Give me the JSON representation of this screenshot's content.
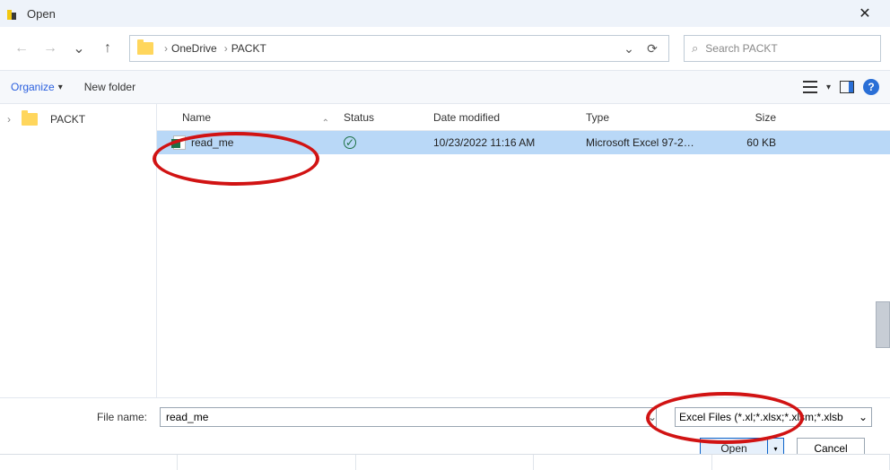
{
  "window": {
    "title": "Open"
  },
  "nav": {
    "back_hint": "←",
    "forward_hint": "→",
    "recent_hint": "⌄",
    "up_hint": "↑"
  },
  "breadcrumbs": [
    "OneDrive",
    "PACKT"
  ],
  "addressbar": {
    "history_dropdown": "⌄",
    "refresh": "⟳"
  },
  "search": {
    "icon": "⌕",
    "placeholder": "Search PACKT"
  },
  "toolbar": {
    "organize": "Organize",
    "newfolder": "New folder",
    "caret": "▾"
  },
  "sidebar": {
    "items": [
      {
        "label": "PACKT"
      }
    ]
  },
  "columns": {
    "name": "Name",
    "status": "Status",
    "date": "Date modified",
    "type": "Type",
    "size": "Size",
    "sort_indicator": "⌃"
  },
  "files": [
    {
      "name": "read_me",
      "status": "synced",
      "date": "10/23/2022 11:16 AM",
      "type": "Microsoft Excel 97-2…",
      "size": "60 KB"
    }
  ],
  "footer": {
    "filename_label": "File name:",
    "filename_value": "read_me",
    "filetype_label": "Excel Files (*.xl;*.xlsx;*.xlsm;*.xlsb",
    "open": "Open",
    "open_more": "▾",
    "cancel": "Cancel",
    "filename_dropdown": "⌄",
    "filetype_dropdown": "⌄"
  },
  "icons": {
    "close": "✕",
    "help": "?",
    "status_check": "✓",
    "chevron_right": "›"
  }
}
